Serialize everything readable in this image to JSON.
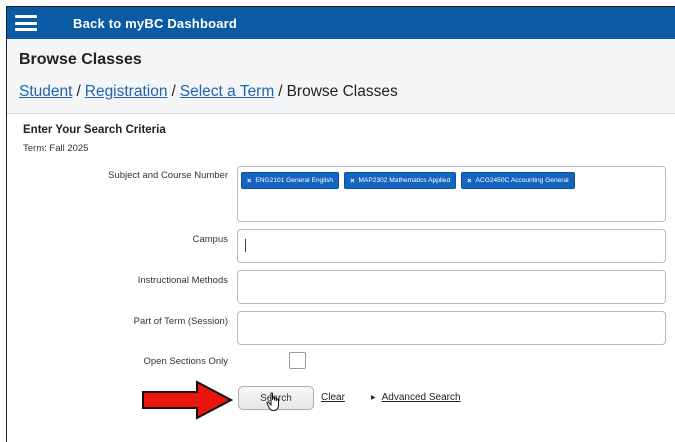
{
  "topbar": {
    "menu_icon": "hamburger-menu-icon",
    "back_link": "Back to myBC Dashboard"
  },
  "header": {
    "page_title": "Browse Classes",
    "breadcrumb": [
      {
        "label": "Student",
        "link": true
      },
      {
        "label": "Registration",
        "link": true
      },
      {
        "label": "Select a Term",
        "link": true
      },
      {
        "label": "Browse Classes",
        "link": false
      }
    ],
    "separator": "/"
  },
  "form": {
    "heading": "Enter Your Search Criteria",
    "term": "Term: Fall 2025",
    "subject_label": "Subject and Course Number",
    "subject_chips": [
      "ENG2101 General English",
      "MAP2302 Mathematics Applied",
      "ACG2450C Accounting General"
    ],
    "chip_remove_glyph": "×",
    "campus_label": "Campus",
    "campus_value": "",
    "instructional_label": "Instructional Methods",
    "instructional_value": "",
    "part_of_term_label": "Part of Term (Session)",
    "part_of_term_value": "",
    "open_sections_label": "Open Sections Only",
    "open_sections_checked": false
  },
  "actions": {
    "search_label": "Search",
    "clear_label": "Clear",
    "advanced_label": "Advanced Search",
    "advanced_glyph": "▶"
  },
  "colors": {
    "topbar": "#0b5aa6",
    "chip": "#1565c0",
    "link": "#1e64b0",
    "annotation_arrow": "#e8160c"
  }
}
